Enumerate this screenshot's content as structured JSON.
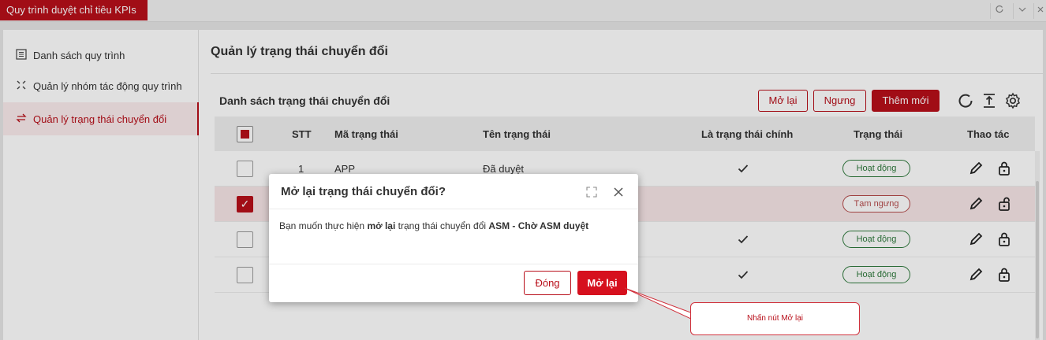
{
  "app_tab": "Quy trình duyệt chỉ tiêu KPIs",
  "top_controls": [
    {
      "icon": "refresh-icon"
    },
    {
      "icon": "chevron-down-icon"
    },
    {
      "icon": "close-icon"
    }
  ],
  "sidebar": {
    "items": [
      {
        "label": "Danh sách quy trình",
        "icon": "list-icon",
        "active": false
      },
      {
        "label": "Quản lý nhóm tác động quy trình",
        "icon": "expand-icon",
        "active": false
      },
      {
        "label": "Quản lý trạng thái chuyển đổi",
        "icon": "swap-icon",
        "active": true
      }
    ]
  },
  "main": {
    "title": "Quản lý trạng thái chuyển đổi",
    "list_title": "Danh sách trạng thái chuyển đổi",
    "buttons": {
      "reopen": "Mở lại",
      "stop": "Ngưng",
      "add": "Thêm mới"
    },
    "tools": [
      "refresh-icon",
      "export-icon",
      "settings-icon"
    ],
    "table": {
      "headers": {
        "stt": "STT",
        "code": "Mã trạng thái",
        "name": "Tên trạng thái",
        "main": "Là trạng thái chính",
        "status": "Trạng thái",
        "actions": "Thao tác"
      },
      "rows": [
        {
          "stt": "1",
          "code": "APP",
          "name": "Đã duyệt",
          "is_main": true,
          "status": "Hoạt động",
          "active": true,
          "selected": false
        },
        {
          "stt": "",
          "code": "",
          "name": "",
          "is_main": false,
          "status": "Tạm ngưng",
          "active": false,
          "selected": true
        },
        {
          "stt": "",
          "code": "",
          "name": "",
          "is_main": true,
          "status": "Hoạt động",
          "active": true,
          "selected": false
        },
        {
          "stt": "",
          "code": "",
          "name": "",
          "is_main": true,
          "status": "Hoạt động",
          "active": true,
          "selected": false
        }
      ]
    }
  },
  "modal": {
    "title": "Mở lại trạng thái chuyển đổi?",
    "body_prefix": "Bạn muốn thực hiện ",
    "body_action": "mở lại",
    "body_middle": " trạng thái chuyển đổi ",
    "body_target": "ASM - Chờ ASM duyệt",
    "close_label": "Đóng",
    "confirm_label": "Mở lại"
  },
  "callout": {
    "text": "Nhấn nút Mở lại"
  },
  "colors": {
    "accent": "#b80f1a",
    "active_badge": "#2f7a3d",
    "paused_badge": "#b54a4a"
  }
}
